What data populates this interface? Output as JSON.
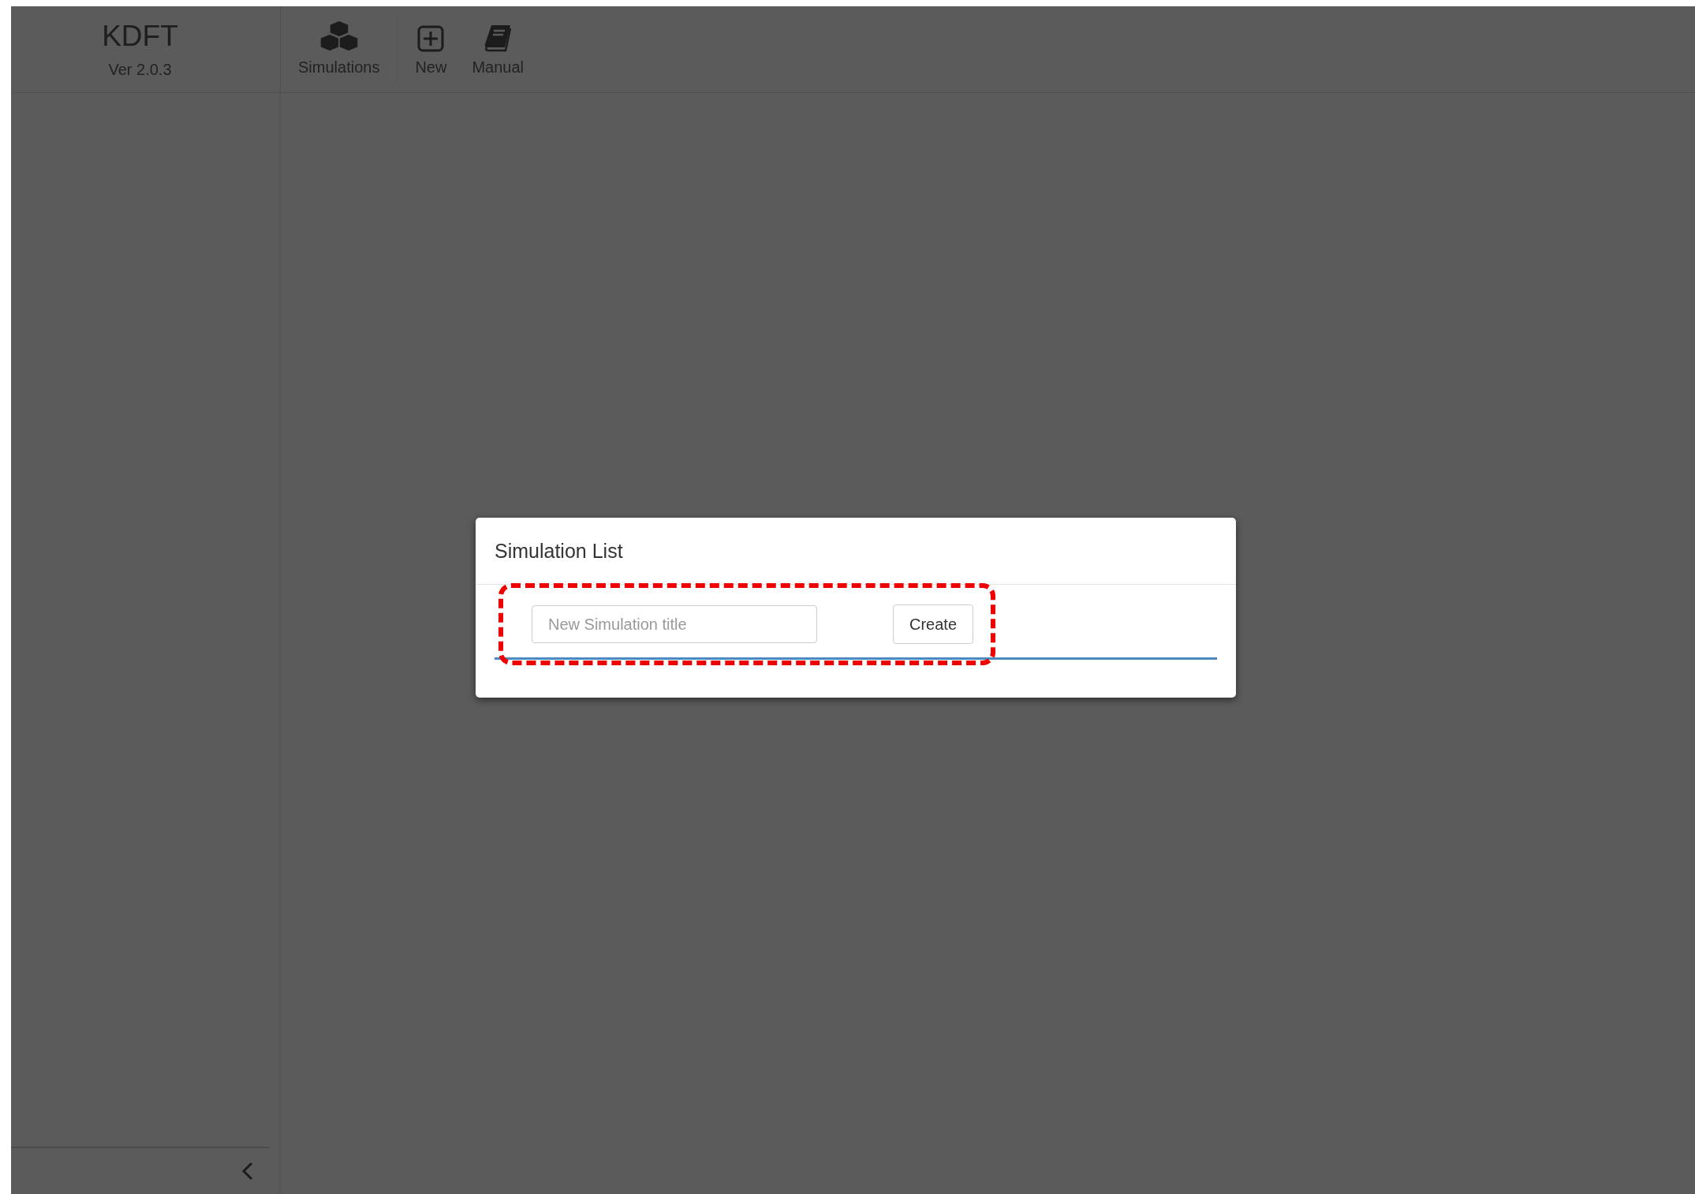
{
  "brand": {
    "title": "KDFT",
    "version": "Ver 2.0.3"
  },
  "toolbar": [
    {
      "label": "Simulations"
    },
    {
      "label": "New"
    },
    {
      "label": "Manual"
    }
  ],
  "dialog": {
    "title": "Simulation List",
    "input": {
      "placeholder": "New Simulation title"
    },
    "button": "Create",
    "highlight": true
  }
}
